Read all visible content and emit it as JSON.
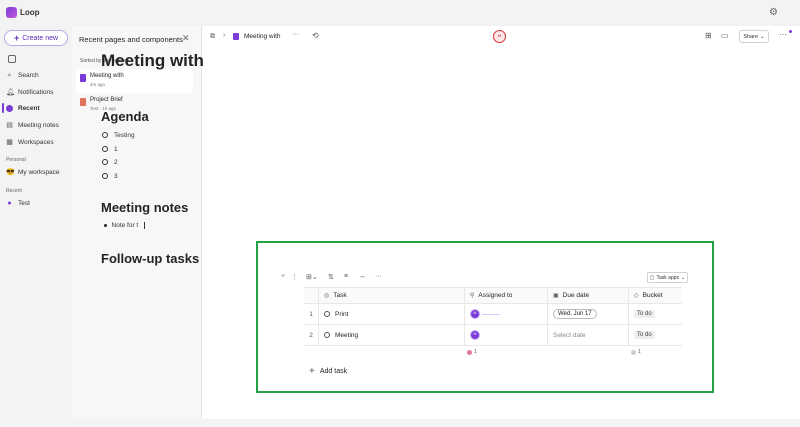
{
  "app": {
    "title": "Loop"
  },
  "sidebar": {
    "create_label": "Create new",
    "items": [
      {
        "label": "Search",
        "icon": "search-icon"
      },
      {
        "label": "Notifications",
        "icon": "bell-icon"
      },
      {
        "label": "Recent",
        "icon": "recent-icon"
      },
      {
        "label": "Meeting notes",
        "icon": "notes-icon"
      },
      {
        "label": "Workspaces",
        "icon": "workspaces-icon"
      }
    ],
    "personal_heading": "Personal",
    "personal_item": "My workspace",
    "recent_heading": "Recent",
    "recent_item": "Test"
  },
  "recent_panel": {
    "title": "Recent pages and components",
    "sort_label": "Sorted by last opened",
    "items": [
      {
        "name": "Meeting with",
        "meta": "4m ago"
      },
      {
        "name": "Project Brief",
        "meta": "Test · 1h ago"
      }
    ]
  },
  "topbar": {
    "breadcrumb": "Meeting with",
    "presence_initials": "M",
    "share_label": "Share",
    "more_label": "···"
  },
  "doc": {
    "title": "Meeting with",
    "agenda_heading": "Agenda",
    "agenda_items": [
      "Testing",
      "1",
      "2",
      "3"
    ],
    "notes_heading": "Meeting notes",
    "note_text": "Note for t",
    "followup_heading": "Follow-up tasks"
  },
  "task_table": {
    "task_apps_label": "Task apps",
    "headers": {
      "task": "Task",
      "assigned": "Assigned to",
      "due": "Due date",
      "bucket": "Bucket"
    },
    "rows": [
      {
        "num": "1",
        "task": "Print",
        "assignee": "M",
        "due": "Wed, Jun 17",
        "bucket": "To do"
      },
      {
        "num": "2",
        "task": "Meeting",
        "assignee": "M",
        "due": "Select date",
        "bucket": "To do"
      }
    ],
    "summary_assigned": "1",
    "summary_bucket": "1",
    "add_label": "Add task"
  },
  "colors": {
    "accent": "#7b3bd6",
    "highlight": "#22a245"
  }
}
